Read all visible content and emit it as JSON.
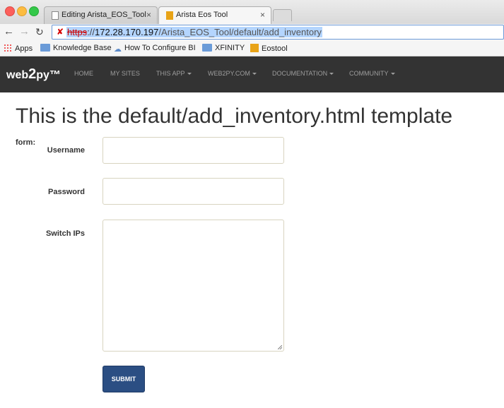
{
  "browser": {
    "tabs": [
      {
        "title": "Editing Arista_EOS_Tool",
        "close": "×"
      },
      {
        "title": "Arista Eos Tool",
        "close": "×"
      }
    ],
    "url": {
      "scheme": "https",
      "separator": "://",
      "host": "172.28.170.197",
      "path": "/Arista_EOS_Tool/default/add_inventory"
    },
    "bookmarks": [
      "Apps",
      "Knowledge Base",
      "How To Configure BI",
      "XFINITY",
      "Eostool"
    ]
  },
  "navbar": {
    "brand_prefix": "web",
    "brand_two": "2",
    "brand_suffix": "py™",
    "items": [
      "HOME",
      "MY SITES",
      "THIS APP",
      "WEB2PY.COM",
      "DOCUMENTATION",
      "COMMUNITY"
    ]
  },
  "page": {
    "heading": "This is the default/add_inventory.html template",
    "form_label": "form:",
    "fields": {
      "username_label": "Username",
      "password_label": "Password",
      "switch_ips_label": "Switch IPs"
    },
    "submit_label": "SUBMIT"
  }
}
